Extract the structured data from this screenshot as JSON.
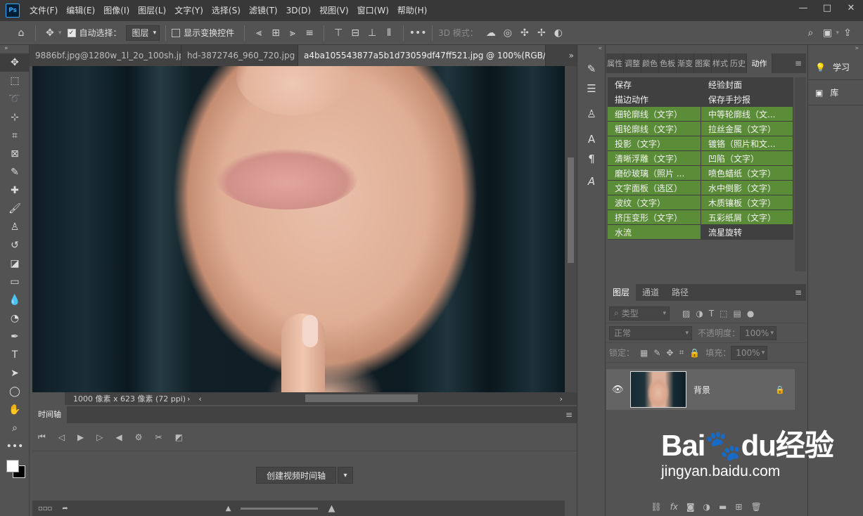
{
  "app": {
    "logo": "Ps"
  },
  "menu": [
    "文件(F)",
    "编辑(E)",
    "图像(I)",
    "图层(L)",
    "文字(Y)",
    "选择(S)",
    "滤镜(T)",
    "3D(D)",
    "视图(V)",
    "窗口(W)",
    "帮助(H)"
  ],
  "window_controls": {
    "minimize": "—",
    "maximize": "□",
    "close": "✕"
  },
  "options": {
    "auto_select_label": "自动选择：",
    "auto_select_checked": true,
    "auto_select_target": "图层",
    "show_transform_label": "显示变换控件",
    "show_transform_checked": false,
    "mode_3d_label": "3D 模式："
  },
  "tabs": [
    {
      "label": "9886bf.jpg@1280w_1l_2o_100sh.jpg",
      "active": false
    },
    {
      "label": "hd-3872746_960_720.jpg",
      "active": false
    },
    {
      "label": "a4ba105543877a5b1d73059df47ff521.jpg @ 100%(RGB/8#)",
      "active": true
    }
  ],
  "status": {
    "doc_info": "1000 像素 x 623 像素 (72 ppi)"
  },
  "timeline": {
    "tab": "时间轴",
    "create_button": "创建视频时间轴"
  },
  "actions_panel": {
    "tabs": [
      "属性",
      "调整",
      "颜色",
      "色板",
      "渐变",
      "图案",
      "样式",
      "历史",
      "动作"
    ],
    "items": [
      {
        "left": "保存",
        "right": "经验封面",
        "left_color": "gray",
        "right_color": "gray"
      },
      {
        "left": "描边动作",
        "right": "保存手抄报",
        "left_color": "gray",
        "right_color": "gray"
      },
      {
        "left": "细轮廓线（文字）",
        "right": "中等轮廓线（文...",
        "left_color": "green",
        "right_color": "green"
      },
      {
        "left": "粗轮廓线（文字）",
        "right": "拉丝金属（文字）",
        "left_color": "green",
        "right_color": "green"
      },
      {
        "left": "投影（文字）",
        "right": "镀铬（照片和文...",
        "left_color": "green",
        "right_color": "green"
      },
      {
        "left": "清晰浮雕（文字）",
        "right": "凹陷（文字）",
        "left_color": "green",
        "right_color": "green"
      },
      {
        "left": "磨砂玻璃（照片 ...",
        "right": "喷色蜡纸（文字）",
        "left_color": "green",
        "right_color": "green"
      },
      {
        "left": "文字面板（选区）",
        "right": "水中倒影（文字）",
        "left_color": "green",
        "right_color": "green"
      },
      {
        "left": "波纹（文字）",
        "right": "木质镶板（文字）",
        "left_color": "green",
        "right_color": "green"
      },
      {
        "left": "挤压变形（文字）",
        "right": "五彩纸屑（文字）",
        "left_color": "green",
        "right_color": "green"
      },
      {
        "left": "水流",
        "right": "流星旋转",
        "left_color": "green",
        "right_color": "gray"
      }
    ]
  },
  "layers_panel": {
    "tabs": [
      "图层",
      "通道",
      "路径"
    ],
    "filter_placeholder": "类型",
    "blend_mode": "正常",
    "opacity_label": "不透明度：",
    "opacity_value": "100%",
    "lock_label": "锁定：",
    "fill_label": "填充：",
    "fill_value": "100%",
    "layers": [
      {
        "name": "背景",
        "visible": true,
        "locked": true
      }
    ]
  },
  "side_panels": {
    "learn": "学习",
    "library": "库"
  },
  "watermark": {
    "logo": "Bai🐾du经验",
    "url": "jingyan.baidu.com"
  },
  "colors": {
    "accent_green": "#5b8c37",
    "panel_bg": "#535353",
    "dark_bg": "#383838"
  }
}
